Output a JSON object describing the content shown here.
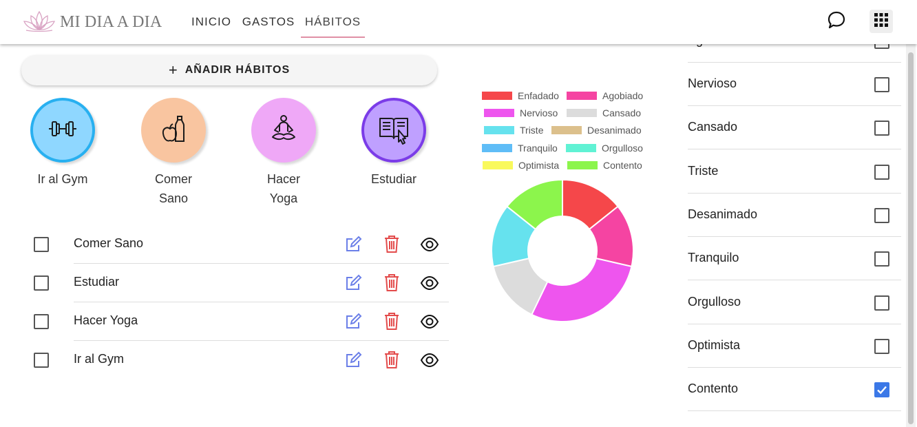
{
  "brand": {
    "name": "MI DIA A DIA"
  },
  "nav": [
    {
      "label": "INICIO",
      "active": false
    },
    {
      "label": "GASTOS",
      "active": false
    },
    {
      "label": "HÁBITOS",
      "active": true
    }
  ],
  "header_icons": [
    "chat-bubble-icon",
    "apps-grid-icon"
  ],
  "add_button": {
    "label": "AÑADIR HÁBITOS",
    "icon": "plus-icon"
  },
  "habits": [
    {
      "name": "Ir al Gym",
      "icon": "dumbbell-icon",
      "color": "#8fd7ff",
      "ring": "#28b0f0"
    },
    {
      "name": "Comer Sano",
      "icon": "apple-bottle-icon",
      "color": "#f9c5a0",
      "ring": ""
    },
    {
      "name": "Hacer Yoga",
      "icon": "yoga-pose-icon",
      "color": "#efa8f7",
      "ring": ""
    },
    {
      "name": "Estudiar",
      "icon": "book-pointer-icon",
      "color": "#bfa0ff",
      "ring": "#7b3ce8"
    }
  ],
  "habit_list": [
    {
      "name": "Comer Sano",
      "checked": false
    },
    {
      "name": "Estudiar",
      "checked": false
    },
    {
      "name": "Hacer Yoga",
      "checked": false
    },
    {
      "name": "Ir al Gym",
      "checked": false
    }
  ],
  "row_icons": [
    "edit-icon",
    "trash-icon",
    "eye-icon"
  ],
  "chart_data": {
    "type": "doughnut",
    "legend_position": "top",
    "labels": [
      "Enfadado",
      "Agobiado",
      "Nervioso",
      "Cansado",
      "Triste",
      "Desanimado",
      "Tranquilo",
      "Orgulloso",
      "Optimista",
      "Contento"
    ],
    "colors": [
      "#f5474a",
      "#f544a2",
      "#ee55ee",
      "#dcdcdc",
      "#66e2ee",
      "#dcc08c",
      "#5fbdf7",
      "#60f2d4",
      "#f9f95c",
      "#8cf54c"
    ],
    "values": [
      1,
      1,
      2,
      1,
      1,
      0,
      0,
      0,
      0,
      1
    ]
  },
  "moods": [
    {
      "name": "Agobiado",
      "checked": false
    },
    {
      "name": "Nervioso",
      "checked": false
    },
    {
      "name": "Cansado",
      "checked": false
    },
    {
      "name": "Triste",
      "checked": false
    },
    {
      "name": "Desanimado",
      "checked": false
    },
    {
      "name": "Tranquilo",
      "checked": false
    },
    {
      "name": "Orgulloso",
      "checked": false
    },
    {
      "name": "Optimista",
      "checked": false
    },
    {
      "name": "Contento",
      "checked": true
    }
  ]
}
